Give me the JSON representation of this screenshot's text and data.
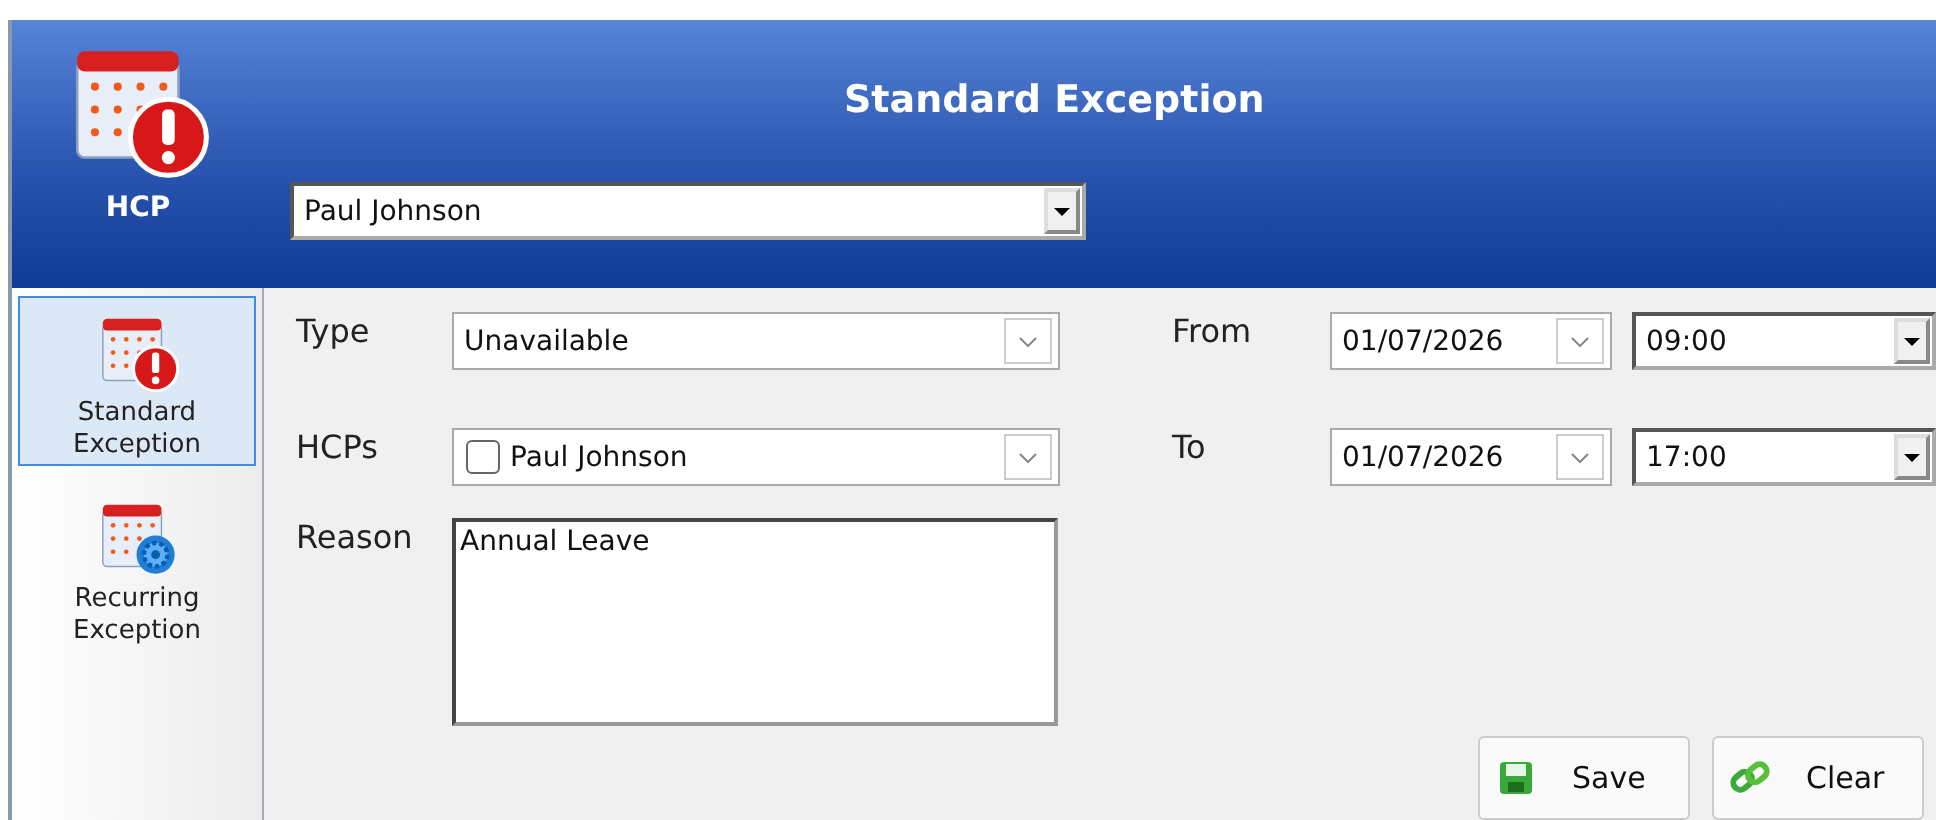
{
  "header": {
    "app_label": "HCP",
    "title": "Standard Exception",
    "hcp_select": "Paul Johnson"
  },
  "sidebar": {
    "items": [
      {
        "label": "Standard Exception",
        "kind": "standard",
        "selected": true
      },
      {
        "label": "Recurring Exception",
        "kind": "recurring",
        "selected": false
      }
    ]
  },
  "form": {
    "type": {
      "label": "Type",
      "value": "Unavailable"
    },
    "hcps": {
      "label": "HCPs",
      "value": "Paul Johnson",
      "checked": false
    },
    "reason": {
      "label": "Reason",
      "value": "Annual Leave"
    },
    "from": {
      "label": "From",
      "date": "01/07/2026",
      "time": "09:00"
    },
    "to": {
      "label": "To",
      "date": "01/07/2026",
      "time": "17:00"
    }
  },
  "buttons": [
    {
      "label": "Save",
      "kind": "save"
    },
    {
      "label": "Clear",
      "kind": "clear"
    }
  ]
}
